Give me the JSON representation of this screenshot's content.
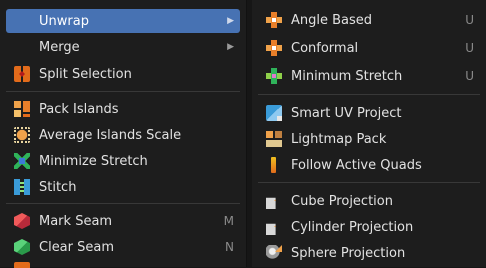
{
  "left_menu": {
    "items": [
      {
        "label": "Unwrap",
        "submenu": true,
        "icon": "blank"
      },
      {
        "label": "Merge",
        "submenu": true,
        "icon": "blank"
      },
      {
        "label": "Split Selection",
        "icon": "split-selection-icon"
      },
      {
        "label": "Pack Islands",
        "icon": "pack-islands-icon"
      },
      {
        "label": "Average Islands Scale",
        "icon": "average-islands-scale-icon"
      },
      {
        "label": "Minimize Stretch",
        "icon": "minimize-stretch-icon"
      },
      {
        "label": "Stitch",
        "icon": "stitch-icon"
      },
      {
        "label": "Mark Seam",
        "shortcut": "M",
        "icon": "mark-seam-icon"
      },
      {
        "label": "Clear Seam",
        "shortcut": "N",
        "icon": "clear-seam-icon"
      }
    ],
    "arrow_glyph": "▶"
  },
  "right_menu": {
    "items": [
      {
        "label": "Angle Based",
        "shortcut": "U",
        "icon": "angle-based-icon"
      },
      {
        "label": "Conformal",
        "shortcut": "U",
        "icon": "conformal-icon"
      },
      {
        "label": "Minimum Stretch",
        "shortcut": "U",
        "icon": "minimum-stretch-icon"
      },
      {
        "label": "Smart UV Project",
        "icon": "smart-uv-project-icon"
      },
      {
        "label": "Lightmap Pack",
        "icon": "lightmap-pack-icon"
      },
      {
        "label": "Follow Active Quads",
        "icon": "follow-active-quads-icon"
      },
      {
        "label": "Cube Projection",
        "icon": "cube-projection-icon"
      },
      {
        "label": "Cylinder Projection",
        "icon": "cylinder-projection-icon"
      },
      {
        "label": "Sphere Projection",
        "icon": "sphere-projection-icon"
      }
    ]
  },
  "colors": {
    "menu_background": "#1d1d1d",
    "active_highlight": "#4772b3",
    "text": "#e2e2e2",
    "shortcut_text": "#8a8a8a",
    "separator": "#383838"
  }
}
